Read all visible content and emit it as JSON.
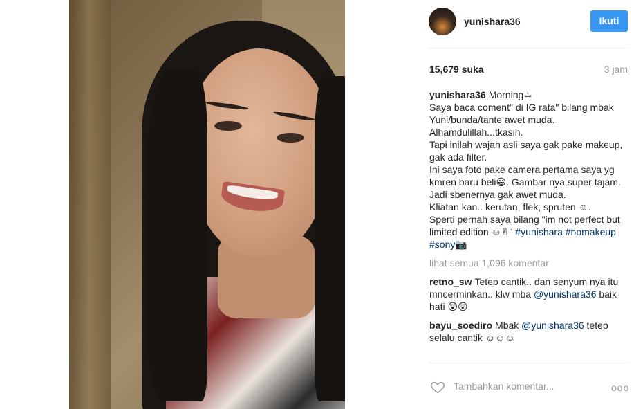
{
  "post": {
    "username": "yunishara36",
    "follow_label": "Ikuti",
    "likes": "15,679 suka",
    "time": "3 jam",
    "caption_user": "yunishara36",
    "caption_lines": [
      "Morning☕",
      "Saya baca coment\" di IG rata\" bilang mbak Yuni/bunda/tante awet muda.",
      "Alhamdulillah...tkasih.",
      "Tapi inilah wajah asli saya gak pake makeup, gak ada filter.",
      "Ini saya foto pake camera pertama saya yg kmren baru beli😀. Gambar nya super tajam.",
      "Jadi sbenernya gak awet muda.",
      "Kliatan kan.. kerutan, flek, spruten ☺.",
      "Sperti pernah saya bilang \"im not perfect but limited edition ☺✌\""
    ],
    "caption_tags": [
      "#yunishara",
      "#nomakeup",
      "#sony📷"
    ],
    "view_all": "lihat semua 1,096 komentar",
    "comments": [
      {
        "user": "retno_sw",
        "text": "Tetep cantik.. dan senyum nya itu mncerminkan.. klw mba",
        "mention": "@yunishara36",
        "after": "baik hati 😲😲"
      },
      {
        "user": "bayu_soediro",
        "text": "Mbak",
        "mention": "@yunishara36",
        "after": "tetep selalu cantik ☺☺☺"
      }
    ],
    "add_comment_placeholder": "Tambahkan komentar...",
    "more_label": "ooo"
  },
  "icons": {
    "like": "heart-icon",
    "more": "more-options-icon"
  },
  "colors": {
    "follow_button": "#3897f0",
    "link": "#003569",
    "muted": "#999999"
  }
}
